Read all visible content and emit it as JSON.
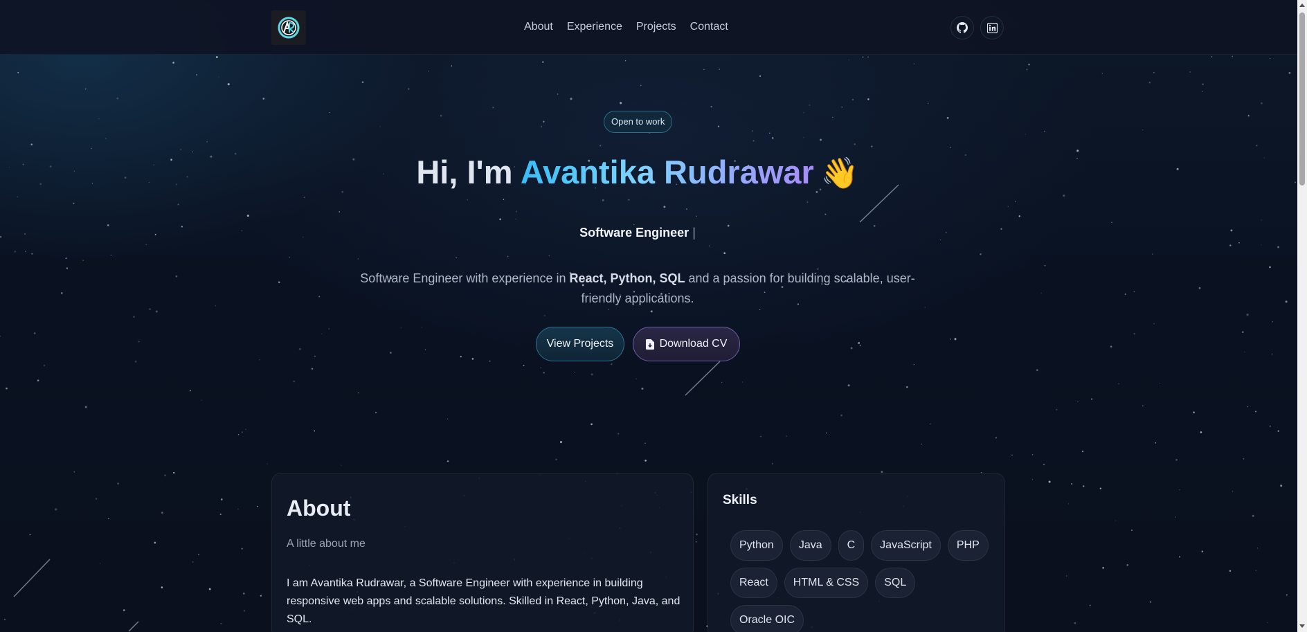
{
  "header": {
    "nav": [
      "About",
      "Experience",
      "Projects",
      "Contact"
    ],
    "social": [
      "github-icon",
      "linkedin-icon"
    ]
  },
  "hero": {
    "badge": "Open to work",
    "greeting": "Hi, I'm ",
    "name": "Avantika Rudrawar",
    "wave": "👋",
    "role": "Software Engineer",
    "caret": "|",
    "intro_prefix": "Software Engineer with experience in ",
    "intro_skills": "React, Python, SQL",
    "intro_suffix": " and a passion for building scalable, user-friendly applications.",
    "buttons": {
      "view_projects": "View Projects",
      "download_cv": "Download CV"
    }
  },
  "about": {
    "heading": "About",
    "subheading": "A little about me",
    "body": "I am Avantika Rudrawar, a Software Engineer with experience in building responsive web apps and scalable solutions. Skilled in React, Python, Java, and SQL."
  },
  "skills": {
    "heading": "Skills",
    "items": [
      "Python",
      "Java",
      "C",
      "JavaScript",
      "PHP",
      "React",
      "HTML & CSS",
      "SQL",
      "Oracle OIC"
    ]
  },
  "colors": {
    "background": "#0b1120",
    "accent_cyan": "#38bdf8",
    "accent_violet": "#a78bfa"
  }
}
